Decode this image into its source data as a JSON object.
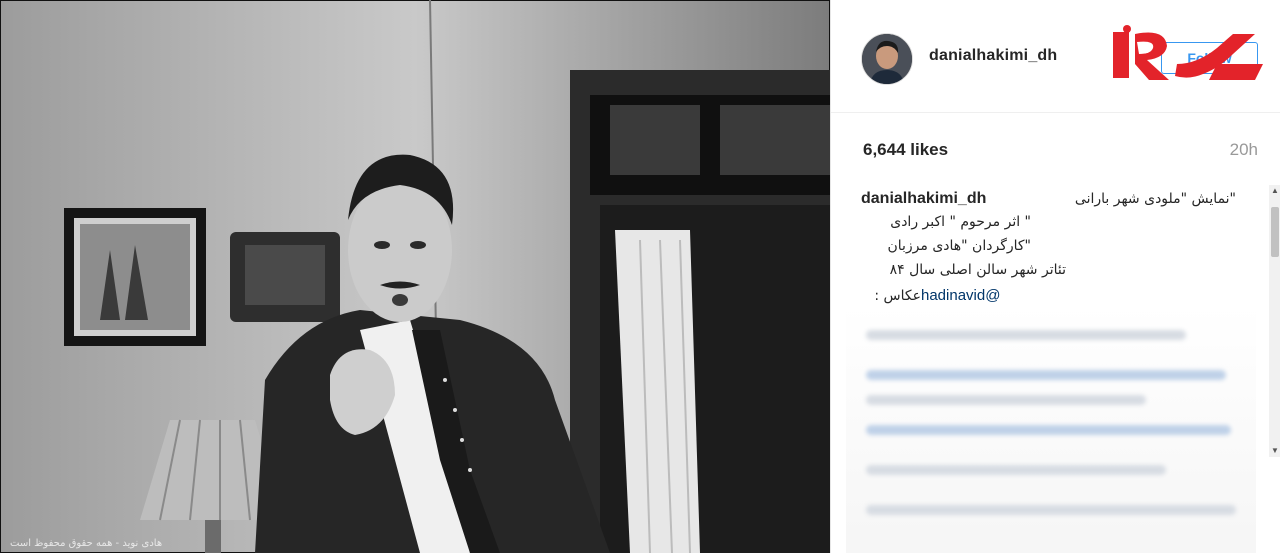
{
  "post": {
    "username": "danialhakimi_dh",
    "follow_label": "Follow",
    "likes": "6,644 likes",
    "time": "20h",
    "watermark": "هادی نوید - همه حقوق محفوظ است"
  },
  "caption": {
    "username": "danialhakimi_dh",
    "lines": [
      "\"نمایش \"ملودی شهر بارانی",
      "\" اثر مرحوم \" اکبر رادی",
      "\"کارگردان \"هادی مرزبان",
      "تئاتر شهر سالن اصلی سال ۸۴",
      "عکاس :"
    ],
    "mention": "@hadinavid"
  },
  "colors": {
    "accent": "#3897f0",
    "logo_red": "#e3232a",
    "mention": "#003569"
  }
}
